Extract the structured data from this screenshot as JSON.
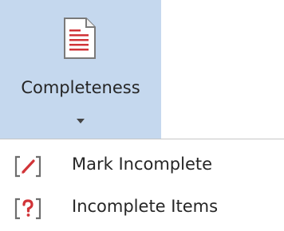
{
  "completeness_button": {
    "label": "Completeness",
    "icon": "document-list-icon",
    "dropdown_icon": "caret-down-icon"
  },
  "menu": {
    "items": [
      {
        "label": "Mark Incomplete",
        "icon": "bracket-pencil-icon"
      },
      {
        "label": "Incomplete Items",
        "icon": "bracket-question-icon"
      }
    ]
  },
  "colors": {
    "button_hover_bg": "#c5d8ee",
    "icon_red": "#d13438",
    "icon_gray": "#6e6e6e",
    "text": "#262626"
  }
}
